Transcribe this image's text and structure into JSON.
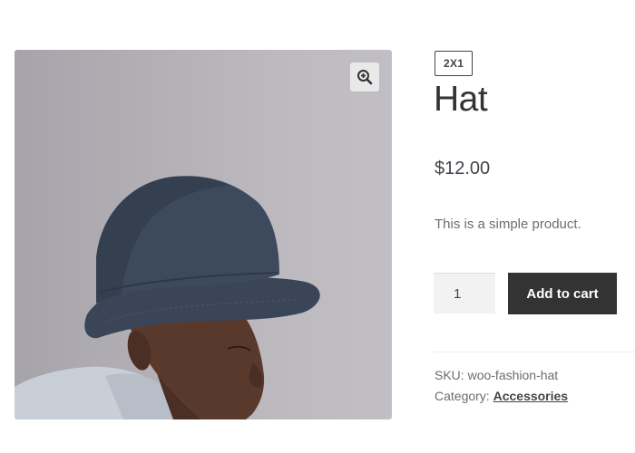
{
  "product": {
    "badge": "2X1",
    "title": "Hat",
    "price": "$12.00",
    "short_description": "This is a simple product.",
    "quantity": "1",
    "add_to_cart_label": "Add to cart",
    "sku_label": "SKU:",
    "sku_value": "woo-fashion-hat",
    "category_label": "Category:",
    "category_value": "Accessories"
  },
  "gallery": {
    "zoom_icon": "zoom-in-icon"
  },
  "colors": {
    "button_bg": "#333333",
    "button_text": "#ffffff",
    "photo_bg": "#b3b0b6",
    "hat": "#3a4558"
  }
}
